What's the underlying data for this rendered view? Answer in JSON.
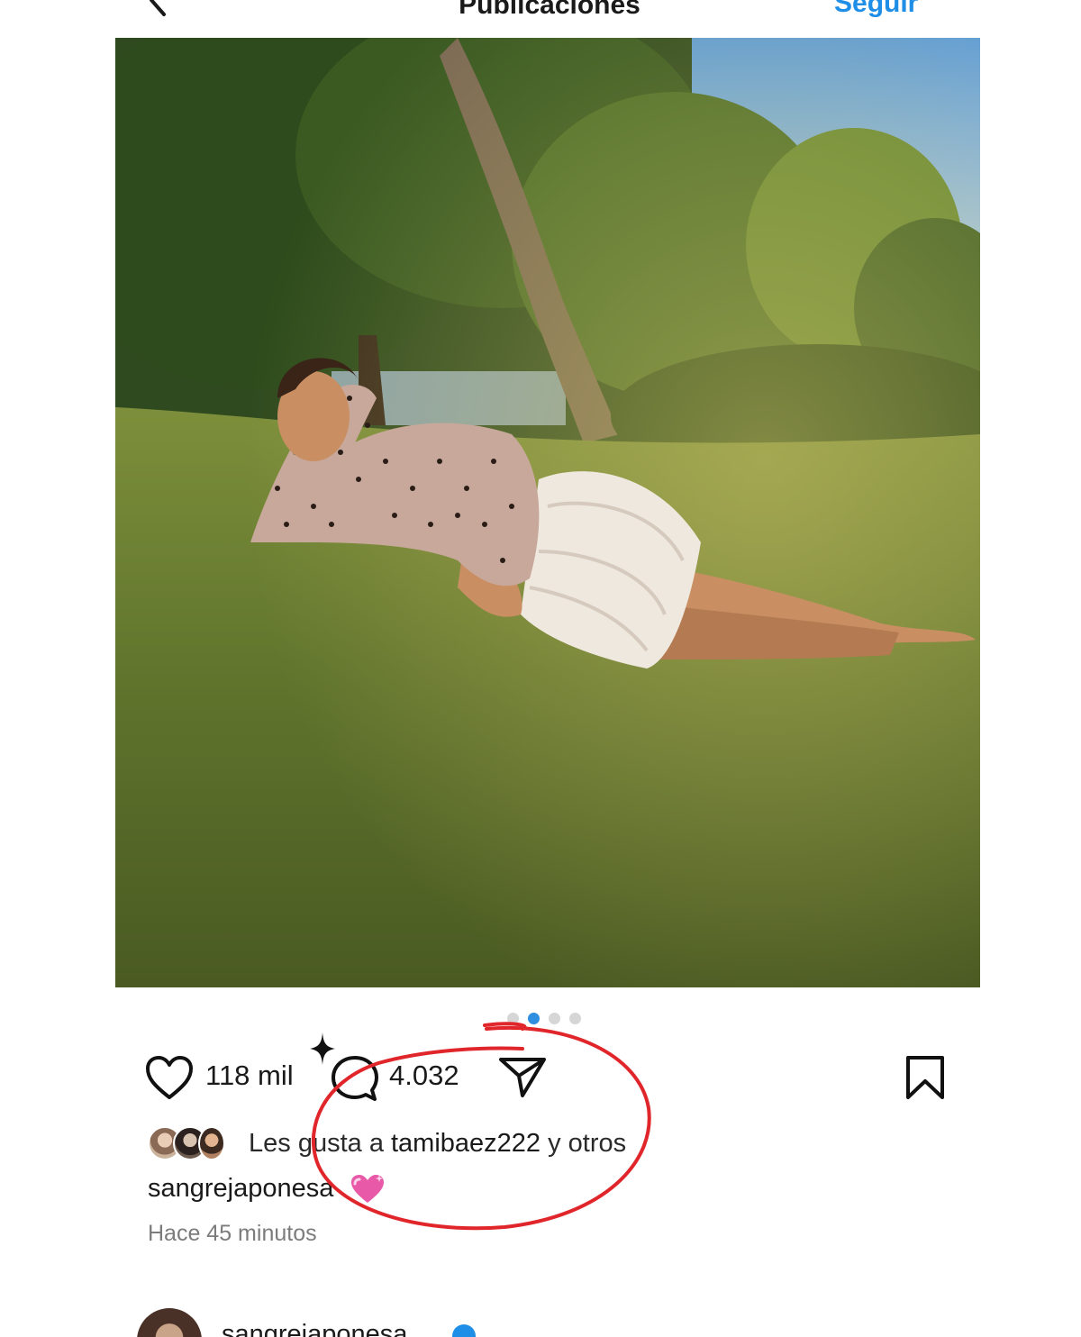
{
  "header": {
    "title": "Publicaciones",
    "follow_label": "Seguir"
  },
  "post": {
    "carousel": {
      "count": 4,
      "active_index": 1
    },
    "like_count": "118 mil",
    "comment_count": "4.032",
    "likes_prefix": "Les gusta a ",
    "likes_user": "tamibaez222",
    "likes_suffix": " y otros",
    "caption_user": "sangrejaponesa",
    "timestamp": "Hace 45 minutos"
  },
  "next_post": {
    "username": "sangrejaponesa"
  },
  "icons": {
    "back": "chevron-left-icon",
    "like": "heart-outline-icon",
    "comment": "comment-bubble-icon",
    "share": "paper-plane-icon",
    "save": "bookmark-outline-icon",
    "caption_emoji": "sparkling-heart-icon",
    "verified": "verified-badge-icon"
  },
  "colors": {
    "accent": "#1f8ee6",
    "active_dot": "#2e8fe0",
    "annotation": "#e0262a",
    "muted_text": "#7c7c7c"
  }
}
